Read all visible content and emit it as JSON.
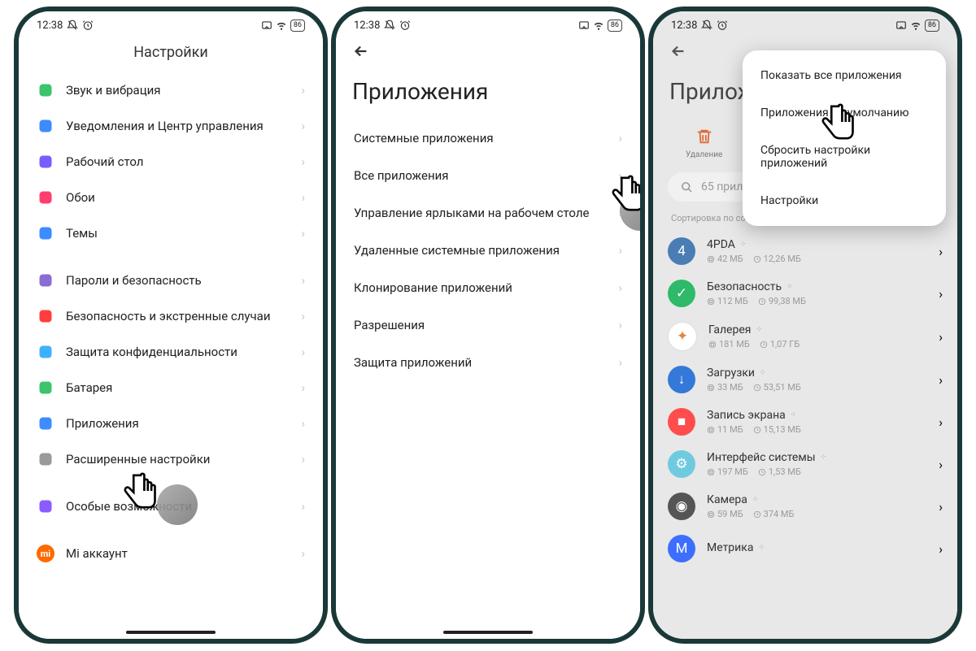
{
  "status": {
    "time": "12:38",
    "battery": "86"
  },
  "screen1": {
    "title": "Настройки",
    "items": [
      {
        "label": "Звук и вибрация",
        "color": "#3cc46a",
        "iconName": "sound-icon"
      },
      {
        "label": "Уведомления и Центр управления",
        "color": "#3d8bff",
        "iconName": "notification-icon"
      },
      {
        "label": "Рабочий стол",
        "color": "#7a5cff",
        "iconName": "home-icon"
      },
      {
        "label": "Обои",
        "color": "#ff3d6e",
        "iconName": "wallpaper-icon"
      },
      {
        "label": "Темы",
        "color": "#3d8bff",
        "iconName": "themes-icon"
      }
    ],
    "items2": [
      {
        "label": "Пароли и безопасность",
        "color": "#8a6dd6",
        "iconName": "password-icon"
      },
      {
        "label": "Безопасность и экстренные случаи",
        "color": "#ff3d3d",
        "iconName": "emergency-icon"
      },
      {
        "label": "Защита конфиденциальности",
        "color": "#3db1ff",
        "iconName": "privacy-icon"
      },
      {
        "label": "Батарея",
        "color": "#3cc46a",
        "iconName": "battery-icon"
      },
      {
        "label": "Приложения",
        "color": "#3d8bff",
        "iconName": "apps-icon"
      },
      {
        "label": "Расширенные настройки",
        "color": "#9a9a9a",
        "iconName": "more-icon"
      }
    ],
    "items3": [
      {
        "label": "Особые возможности",
        "color": "#8a5cff",
        "iconName": "accessibility-icon"
      }
    ],
    "mi": "Mi аккаунт"
  },
  "screen2": {
    "title": "Приложения",
    "items": [
      "Системные приложения",
      "Все приложения",
      "Управление ярлыками на рабочем столе",
      "Удаленные системные приложения",
      "Клонирование приложений",
      "Разрешения",
      "Защита приложений"
    ]
  },
  "screen3": {
    "title": "Приложений",
    "uninstall": "Удаление",
    "menu": [
      "Показать все приложения",
      "Приложения по умолчанию",
      "Сбросить настройки приложений",
      "Настройки"
    ],
    "search": "65 приложений",
    "sort": "Сортировка по состоянию",
    "apps": [
      {
        "name": "4PDA",
        "size1": "42 МБ",
        "size2": "12,26 МБ",
        "bg": "#4a7db5",
        "ch": "4"
      },
      {
        "name": "Безопасность",
        "size1": "112 МБ",
        "size2": "99,38 МБ",
        "bg": "#2fb96a",
        "ch": "✓"
      },
      {
        "name": "Галерея",
        "size1": "181 МБ",
        "size2": "1,07 ГБ",
        "bg": "#fff",
        "ch": "✦"
      },
      {
        "name": "Загрузки",
        "size1": "33 МБ",
        "size2": "53,51 МБ",
        "bg": "#3478d8",
        "ch": "↓"
      },
      {
        "name": "Запись экрана",
        "size1": "11 МБ",
        "size2": "15,13 МБ",
        "bg": "#ff4d4d",
        "ch": "■"
      },
      {
        "name": "Интерфейс системы",
        "size1": "197 МБ",
        "size2": "1,53 МБ",
        "bg": "#6fcae0",
        "ch": "⚙"
      },
      {
        "name": "Камера",
        "size1": "59 МБ",
        "size2": "374 МБ",
        "bg": "#555",
        "ch": "◉"
      },
      {
        "name": "Метрика",
        "size1": "",
        "size2": "",
        "bg": "#3d6eff",
        "ch": "М"
      }
    ]
  }
}
